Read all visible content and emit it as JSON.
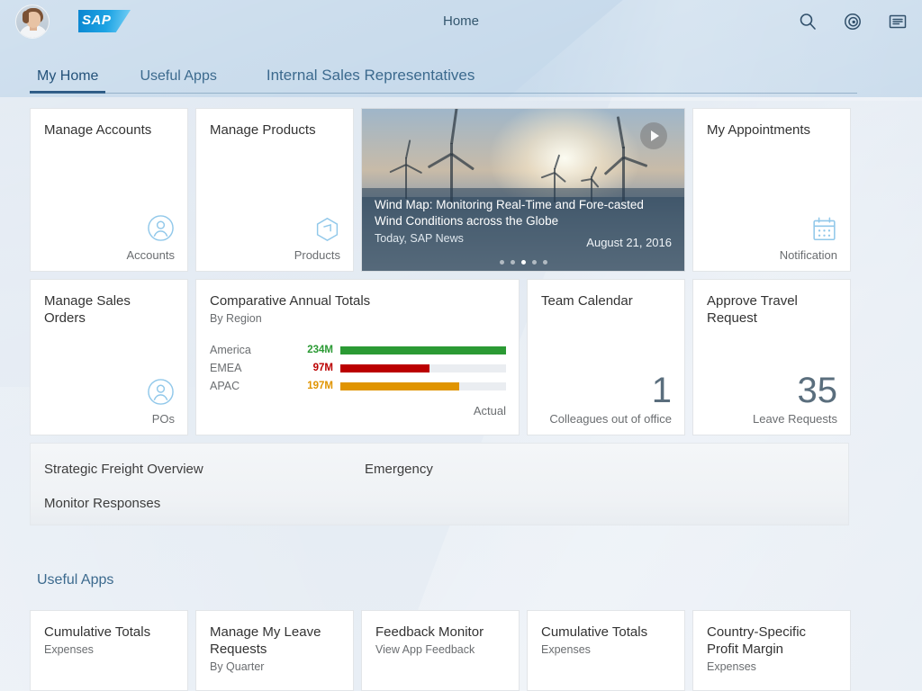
{
  "header": {
    "title": "Home",
    "avatar_name": "user-avatar",
    "logo_text": "SAP",
    "actions": [
      {
        "name": "search-icon",
        "label": "Search"
      },
      {
        "name": "copilot-icon",
        "label": "Co-Pilot"
      },
      {
        "name": "menu-icon",
        "label": "Me Area"
      }
    ]
  },
  "tabs": [
    {
      "label": "My Home",
      "active": true
    },
    {
      "label": "Useful Apps",
      "active": false
    },
    {
      "label": "Internal Sales Representatives",
      "active": false
    }
  ],
  "row1": {
    "tile_accounts": {
      "title": "Manage Accounts",
      "footer": "Accounts",
      "icon": "person-icon"
    },
    "tile_products": {
      "title": "Manage Products",
      "footer": "Products",
      "icon": "product-box-icon"
    },
    "news": {
      "title": "Wind Map: Monitoring Real-Time and Fore-casted Wind Conditions across the Globe",
      "meta": "Today, SAP News",
      "date": "August 21, 2016",
      "play_icon": "play-icon",
      "dots_total": 5,
      "dots_active": 3
    },
    "tile_appointments": {
      "title": "My Appointments",
      "footer": "Notification",
      "icon": "calendar-icon"
    }
  },
  "row2": {
    "tile_sales_orders": {
      "title": "Manage Sales Orders",
      "footer": "POs",
      "icon": "person-icon"
    },
    "tile_team_calendar": {
      "title": "Team Calendar",
      "number": "1",
      "footer": "Colleagues out of office"
    },
    "tile_travel": {
      "title": "Approve Travel Request",
      "number": "35",
      "footer": "Leave Requests"
    }
  },
  "chart_data": {
    "type": "bar",
    "title": "Comparative Annual Totals",
    "subtitle": "By Region",
    "orientation": "horizontal",
    "categories": [
      "America",
      "EMEA",
      "APAC"
    ],
    "values": [
      234,
      97,
      197
    ],
    "value_labels": [
      "234M",
      "97M",
      "197M"
    ],
    "percent_of_track": [
      100,
      54,
      72
    ],
    "colors": [
      "#2b9a34",
      "#bb0000",
      "#e09400"
    ],
    "track_color": "#eaedf1",
    "legend": "Actual",
    "legend_position": "bottom-right",
    "xlabel": "",
    "ylabel": "",
    "grid": false
  },
  "panel": {
    "items": [
      {
        "label": "Strategic Freight Overview"
      },
      {
        "label": "Emergency"
      },
      {
        "label": "Monitor Responses"
      }
    ]
  },
  "section_heading": "Useful Apps",
  "row3": [
    {
      "title": "Cumulative Totals",
      "subtitle": "Expenses"
    },
    {
      "title": "Manage My Leave Requests",
      "subtitle": "By Quarter"
    },
    {
      "title": "Feedback Monitor",
      "subtitle": "View App Feedback"
    },
    {
      "title": "Cumulative Totals",
      "subtitle": "Expenses"
    },
    {
      "title": "Country-Specific Profit Margin",
      "subtitle": "Expenses"
    }
  ],
  "colors": {
    "header_bg": "#bed4e8",
    "page_bg": "#e4ebf3",
    "accent": "#3c6a8e",
    "tile_bg": "#ffffff",
    "tile_icon": "#91c8ea"
  }
}
